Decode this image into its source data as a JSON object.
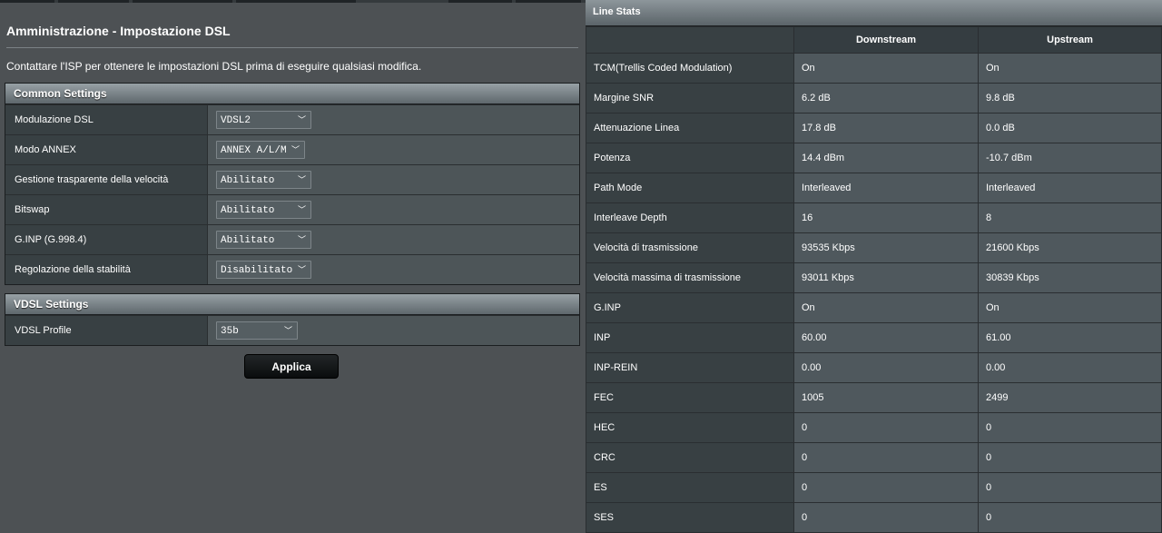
{
  "page": {
    "title": "Amministrazione - Impostazione DSL",
    "intro": "Contattare l'ISP per ottenere le impostazioni DSL prima di eseguire qualsiasi modifica."
  },
  "common_settings": {
    "header": "Common Settings",
    "rows": [
      {
        "label": "Modulazione DSL",
        "value": "VDSL2"
      },
      {
        "label": "Modo ANNEX",
        "value": "ANNEX A/L/M"
      },
      {
        "label": "Gestione trasparente della velocità",
        "value": "Abilitato"
      },
      {
        "label": "Bitswap",
        "value": "Abilitato"
      },
      {
        "label": "G.INP (G.998.4)",
        "value": "Abilitato"
      },
      {
        "label": "Regolazione della stabilità",
        "value": "Disabilitato"
      }
    ]
  },
  "vdsl_settings": {
    "header": "VDSL Settings",
    "rows": [
      {
        "label": "VDSL Profile",
        "value": "35b"
      }
    ]
  },
  "apply_label": "Applica",
  "line_stats": {
    "header": "Line Stats",
    "columns": [
      "Downstream",
      "Upstream"
    ],
    "rows": [
      {
        "label": "TCM(Trellis Coded Modulation)",
        "down": "On",
        "up": "On"
      },
      {
        "label": "Margine SNR",
        "down": "6.2 dB",
        "up": "9.8 dB"
      },
      {
        "label": "Attenuazione Linea",
        "down": "17.8 dB",
        "up": "0.0 dB"
      },
      {
        "label": "Potenza",
        "down": "14.4 dBm",
        "up": "-10.7 dBm"
      },
      {
        "label": "Path Mode",
        "down": "Interleaved",
        "up": "Interleaved"
      },
      {
        "label": "Interleave Depth",
        "down": "16",
        "up": "8"
      },
      {
        "label": "Velocità di trasmissione",
        "down": "93535 Kbps",
        "up": "21600 Kbps"
      },
      {
        "label": "Velocità massima di trasmissione",
        "down": "93011 Kbps",
        "up": "30839 Kbps"
      },
      {
        "label": "G.INP",
        "down": "On",
        "up": "On"
      },
      {
        "label": "INP",
        "down": "60.00",
        "up": "61.00"
      },
      {
        "label": "INP-REIN",
        "down": "0.00",
        "up": "0.00"
      },
      {
        "label": "FEC",
        "down": "1005",
        "up": "2499"
      },
      {
        "label": "HEC",
        "down": "0",
        "up": "0"
      },
      {
        "label": "CRC",
        "down": "0",
        "up": "0"
      },
      {
        "label": "ES",
        "down": "0",
        "up": "0"
      },
      {
        "label": "SES",
        "down": "0",
        "up": "0"
      }
    ]
  },
  "icons": {
    "dropdown": "chevron-down-icon"
  },
  "colors": {
    "page_bg": "#4d5154",
    "label_cell_bg": "#384043",
    "value_cell_bg": "#4f585d",
    "apply_button_bg": "#16191b"
  }
}
